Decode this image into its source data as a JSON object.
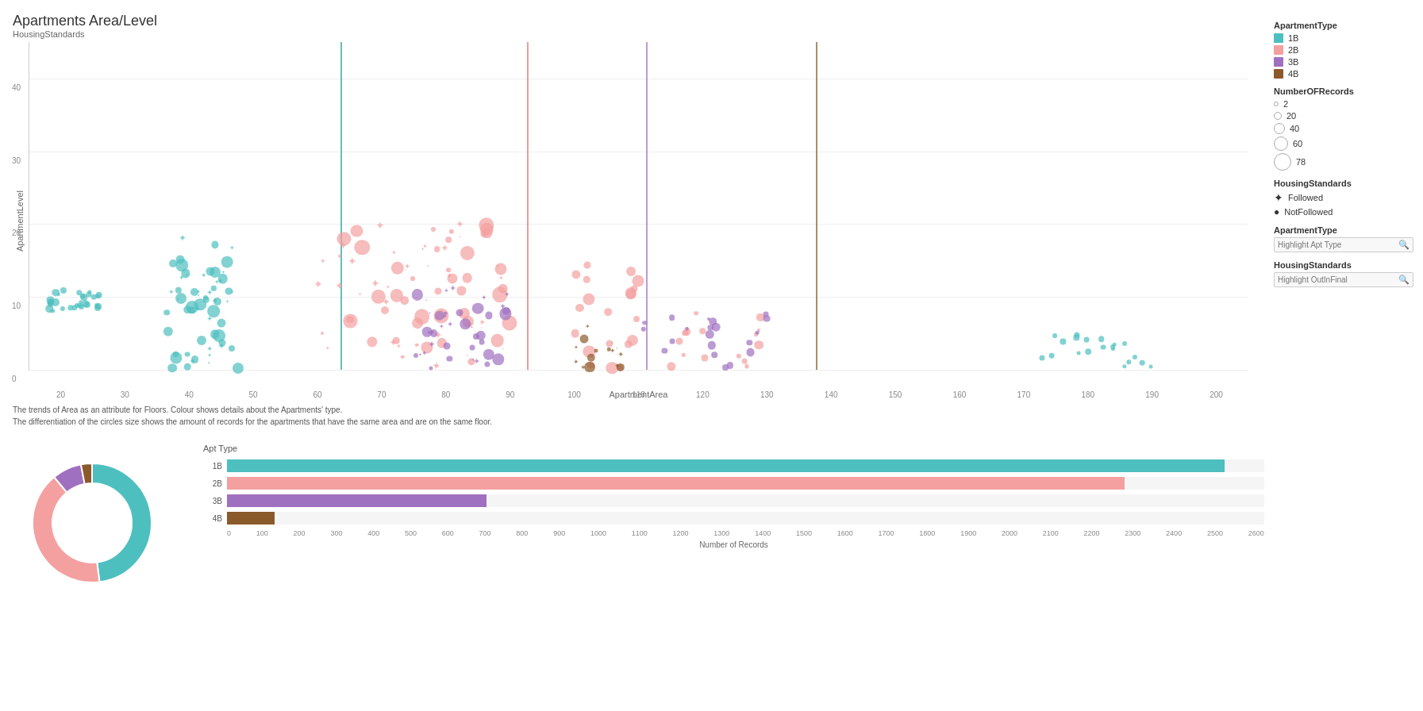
{
  "title": "Apartments Area/Level",
  "subtitle": "HousingStandards",
  "description_line1": "The trends of Area as an attribute for Floors.  Colour shows details about  the Apartments' type.",
  "description_line2": "The differentiation of the circles size shows the amount of records for the apartments that have the same area and are on the same floor.",
  "axes": {
    "y_label": "ApartmentLevel",
    "x_label": "ApartmentArea",
    "y_ticks": [
      "0",
      "10",
      "20",
      "30",
      "40"
    ],
    "x_ticks": [
      "20",
      "30",
      "40",
      "50",
      "60",
      "70",
      "80",
      "90",
      "100",
      "110",
      "120",
      "130",
      "140",
      "150",
      "160",
      "170",
      "180",
      "190",
      "200"
    ]
  },
  "legend": {
    "apt_type_title": "ApartmentType",
    "apt_types": [
      {
        "label": "1B",
        "color": "#4DBFBF"
      },
      {
        "label": "2B",
        "color": "#F4A0A0"
      },
      {
        "label": "3B",
        "color": "#A070C0"
      },
      {
        "label": "4B",
        "color": "#8B5A2B"
      }
    ],
    "records_title": "NumberOFRecords",
    "records": [
      {
        "label": "2",
        "size": 6
      },
      {
        "label": "20",
        "size": 10
      },
      {
        "label": "40",
        "size": 14
      },
      {
        "label": "60",
        "size": 18
      },
      {
        "label": "78",
        "size": 22
      }
    ],
    "housing_title": "HousingStandards",
    "housing": [
      {
        "label": "Followed",
        "symbol": "star"
      },
      {
        "label": "NotFollowed",
        "symbol": "circle"
      }
    ],
    "filter_apt_type_label": "ApartmentType",
    "filter_apt_type_placeholder": "Highlight Apt Type",
    "filter_housing_label": "HousingStandards",
    "filter_housing_placeholder": "Highlight OutInFinal"
  },
  "vertical_lines": [
    {
      "x_pct": 25.5,
      "color": "#2E9E9E"
    },
    {
      "x_pct": 40.8,
      "color": "#E87070"
    },
    {
      "x_pct": 50.6,
      "color": "#A070C0"
    },
    {
      "x_pct": 64.5,
      "color": "#8B5A2B"
    }
  ],
  "bar_chart": {
    "title": "Apt Type",
    "bars": [
      {
        "label": "1B",
        "value": 2500,
        "max": 2600,
        "color": "#4DBFBF"
      },
      {
        "label": "2B",
        "value": 2250,
        "max": 2600,
        "color": "#F4A0A0"
      },
      {
        "label": "3B",
        "value": 650,
        "max": 2600,
        "color": "#A070C0"
      },
      {
        "label": "4B",
        "value": 120,
        "max": 2600,
        "color": "#8B5A2B"
      }
    ],
    "x_ticks": [
      "0",
      "100",
      "200",
      "300",
      "400",
      "500",
      "600",
      "700",
      "800",
      "900",
      "1000",
      "1100",
      "1200",
      "1300",
      "1400",
      "1500",
      "1600",
      "1700",
      "1800",
      "1900",
      "2000",
      "2100",
      "2200",
      "2300",
      "2400",
      "2500",
      "2600"
    ],
    "x_label": "Number of Records"
  },
  "donut": {
    "segments": [
      {
        "label": "1B",
        "color": "#4DBFBF",
        "pct": 48
      },
      {
        "label": "2B",
        "color": "#F4A0A0",
        "pct": 41
      },
      {
        "label": "3B",
        "color": "#A070C0",
        "pct": 8
      },
      {
        "label": "4B",
        "color": "#8B5A2B",
        "pct": 3
      }
    ]
  }
}
